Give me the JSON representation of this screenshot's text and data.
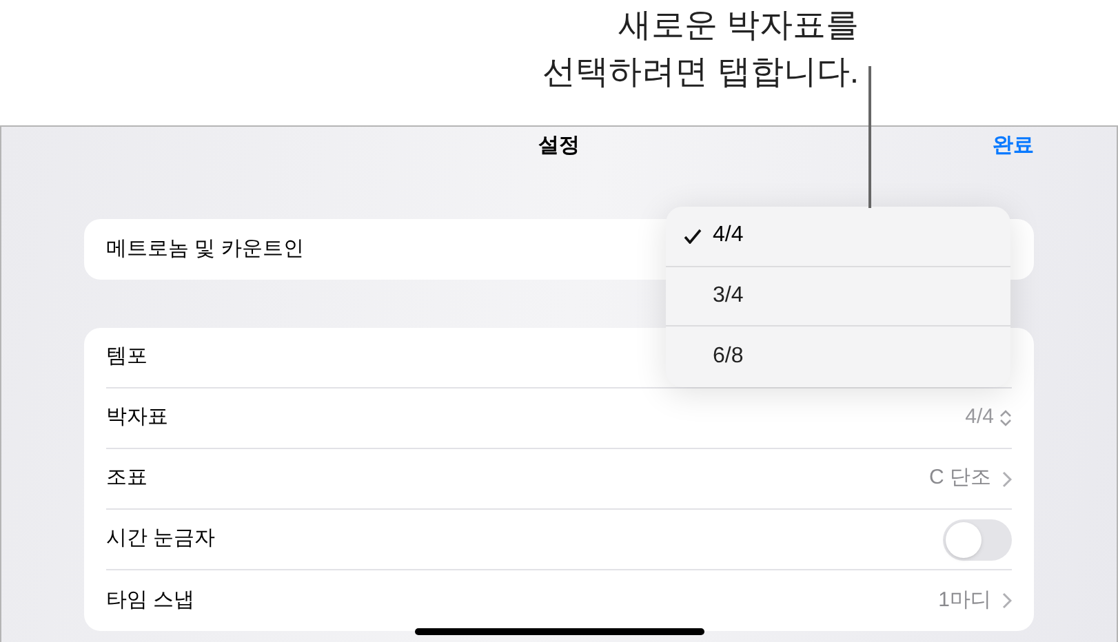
{
  "callout": {
    "lines": [
      "새로운 박자표를",
      "선택하려면 탭합니다."
    ]
  },
  "header": {
    "title": "설정",
    "done": "완료"
  },
  "groups": [
    {
      "rows": [
        {
          "kind": "plain",
          "label": "메트로놈 및 카운트인"
        }
      ]
    },
    {
      "rows": [
        {
          "kind": "plain",
          "label": "템포"
        },
        {
          "kind": "stepper",
          "label": "박자표",
          "value": "4/4"
        },
        {
          "kind": "chevron",
          "label": "조표",
          "value": "C 단조"
        },
        {
          "kind": "toggle",
          "label": "시간 눈금자",
          "on": false
        },
        {
          "kind": "chevron",
          "label": "타임 스냅",
          "value": "1마디"
        }
      ]
    }
  ],
  "menu": {
    "items": [
      {
        "label": "4/4",
        "selected": true
      },
      {
        "label": "3/4",
        "selected": false
      },
      {
        "label": "6/8",
        "selected": false
      }
    ]
  }
}
